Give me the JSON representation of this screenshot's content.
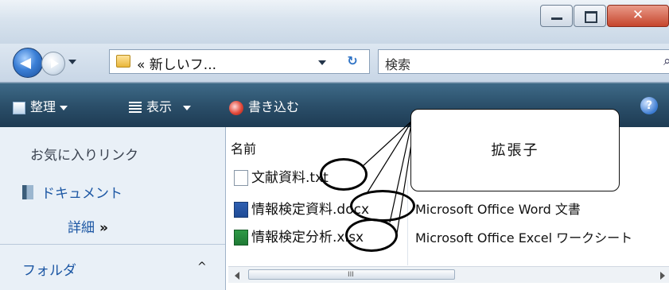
{
  "window": {
    "title_buttons": [
      "minimize",
      "maximize",
      "close"
    ]
  },
  "address": {
    "back_icon": "back-arrow-icon",
    "forward_icon": "forward-arrow-icon",
    "breadcrumb": "« 新しいフ...",
    "refresh_icon": "refresh-icon",
    "search_placeholder": "検索"
  },
  "toolbar": {
    "organize": "整理",
    "views": "表示",
    "burn": "書き込む",
    "help": "?"
  },
  "navpane": {
    "favorites_title": "お気に入りリンク",
    "documents": "ドキュメント",
    "more": "詳細",
    "more_chevron": "»",
    "folders": "フォルダ",
    "folders_caret": "^"
  },
  "files": {
    "column_name": "名前",
    "rows": [
      {
        "name": "文献資料",
        "ext": ".txt",
        "type": "",
        "icon": "text-file-icon"
      },
      {
        "name": "情報検定資料",
        "ext": ".docx",
        "type": "Microsoft Office Word 文書",
        "icon": "word-file-icon"
      },
      {
        "name": "情報検定分析",
        "ext": ".xlsx",
        "type": "Microsoft Office Excel ワークシート",
        "icon": "excel-file-icon"
      }
    ]
  },
  "scrollbar": {
    "grip": "III"
  },
  "callout": {
    "label": "拡張子"
  },
  "colors": {
    "commandbar": "#2b4f6a",
    "link": "#1b56a3",
    "close_button": "#c6452c"
  }
}
